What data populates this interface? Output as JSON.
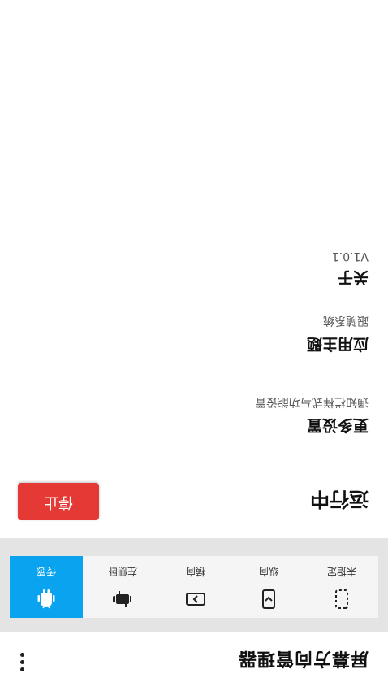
{
  "app": {
    "title": "屏幕方向管理器"
  },
  "modes": [
    {
      "label": "未指定",
      "icon": "dashed-phone-icon"
    },
    {
      "label": "纵向",
      "icon": "portrait-phone-icon"
    },
    {
      "label": "横向",
      "icon": "landscape-phone-icon"
    },
    {
      "label": "左侧卧",
      "icon": "android-lying-icon"
    },
    {
      "label": "传感",
      "icon": "android-icon",
      "active": true
    }
  ],
  "status": {
    "text": "运行中",
    "stop_label": "停止"
  },
  "settings": [
    {
      "title": "更多设置",
      "subtitle": "通知栏样式与功能设置"
    },
    {
      "title": "应用主题",
      "subtitle": "跟随系统"
    },
    {
      "title": "关于",
      "subtitle": "V1.0.1"
    }
  ],
  "colors": {
    "accent": "#0aa3f0",
    "stop": "#e53935",
    "mode_bar": "#e4e4e4"
  }
}
